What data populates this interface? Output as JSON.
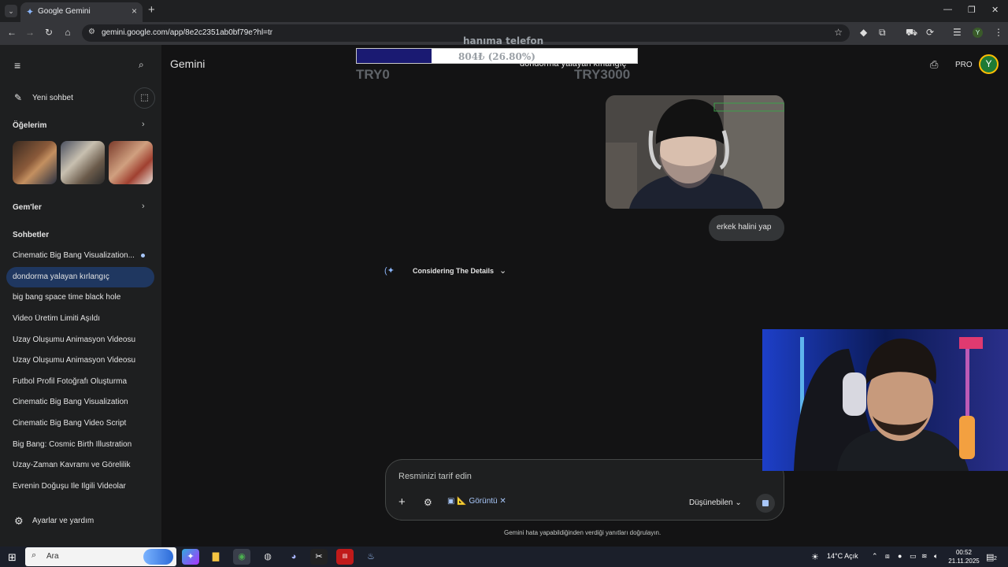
{
  "browser": {
    "tab_title": "Google Gemini",
    "url": "gemini.google.com/app/8e2c2351ab0bf79e?hl=tr",
    "profile_initial": "Y"
  },
  "sidebar": {
    "new_chat": "Yeni sohbet",
    "my_items": "Öğelerim",
    "gems": "Gem'ler",
    "chats_header": "Sohbetler",
    "chats": [
      "Cinematic Big Bang Visualization...",
      "dondorma yalayan kırlangıç",
      "big bang space time black hole",
      "Video Üretim Limiti Aşıldı",
      "Uzay Oluşumu Animasyon Videosu",
      "Uzay Oluşumu Animasyon Videosu",
      "Futbol Profil Fotoğrafı Oluşturma",
      "Cinematic Big Bang Visualization",
      "Cinematic Big Bang Video Script",
      "Big Bang: Cosmic Birth Illustration",
      "Uzay-Zaman Kavramı ve Görelilik",
      "Evrenin Doğuşu İle İlgili Videolar"
    ],
    "settings": "Ayarlar ve yardım"
  },
  "main": {
    "brand": "Gemini",
    "conversation_title": "dondorma yalayan kırlangıç",
    "pro_label": "PRO",
    "avatar_initial": "Y",
    "user_message": "erkek halini yap",
    "thinking_label": "Considering The Details",
    "composer_placeholder": "Resminizi tarif edin",
    "image_chip": "Görüntü",
    "mode_label": "Düşünebilen",
    "disclaimer": "Gemini hata yapabildiğinden verdiği yanıtları doğrulayın."
  },
  "donation": {
    "title": "hanıma telefon",
    "progress_text": "804₺ (26.80%)",
    "progress_fraction": 0.268,
    "min_label": "TRY0",
    "max_label": "TRY3000"
  },
  "taskbar": {
    "search_placeholder": "Ara",
    "weather": "14°C  Açık",
    "time": "00:52",
    "date": "21.11.2025",
    "notifications": "2"
  },
  "colors": {
    "accent": "#8ab4f8",
    "active_chat": "#1f3760",
    "donation_fill": "#1a1a72"
  }
}
